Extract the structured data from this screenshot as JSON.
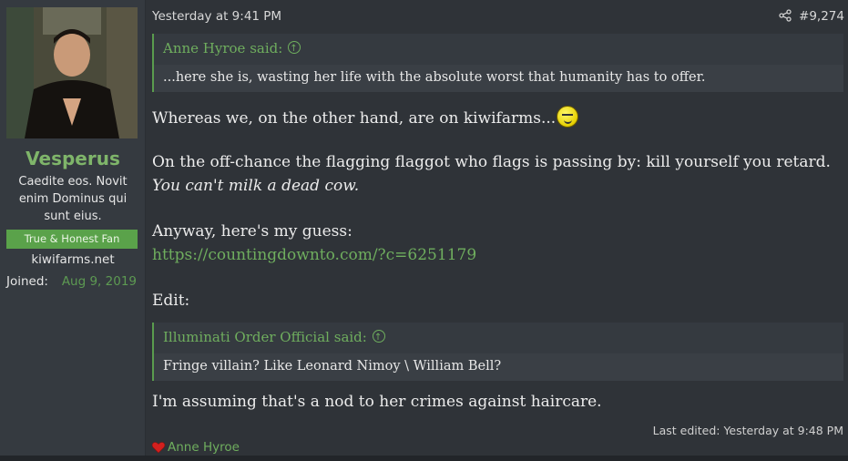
{
  "author": {
    "username": "Vesperus",
    "user_title": "Caedite eos. Novit enim Dominus qui sunt eius.",
    "banner": "True & Honest Fan",
    "website": "kiwifarms.net",
    "joined_label": "Joined:",
    "joined_date": "Aug 9, 2019"
  },
  "post": {
    "date": "Yesterday at 9:41 PM",
    "number": "#9,274",
    "quote1": {
      "attribution": "Anne Hyroe said:",
      "text": "...here she is, wasting her life with the absolute worst that humanity has to offer."
    },
    "line1": "Whereas we, on the other hand, are on kiwifarms...",
    "line2": "On the off-chance the flagging flaggot who flags is passing by: kill yourself you retard.",
    "line3": "You can't milk a dead cow.",
    "line4": "Anyway, here's my guess:",
    "link": "https://countingdownto.com/?c=6251179",
    "line5": "Edit:",
    "quote2": {
      "attribution": "Illuminati Order Official said:",
      "text": "Fringe villain? Like Leonard Nimoy \\ William Bell?"
    },
    "line6": "I'm assuming that's a nod to her crimes against haircare.",
    "last_edited": "Last edited: Yesterday at 9:48 PM",
    "reaction_user": "Anne Hyroe"
  },
  "colors": {
    "accent": "#6fae5e",
    "banner_bg": "#5aa24a",
    "background": "#2f3338"
  },
  "icons": {
    "share": "share-icon",
    "smiley": "smug-smiley-icon",
    "heart": "heart-icon",
    "jump_up": "arrow-up-circle-icon"
  }
}
